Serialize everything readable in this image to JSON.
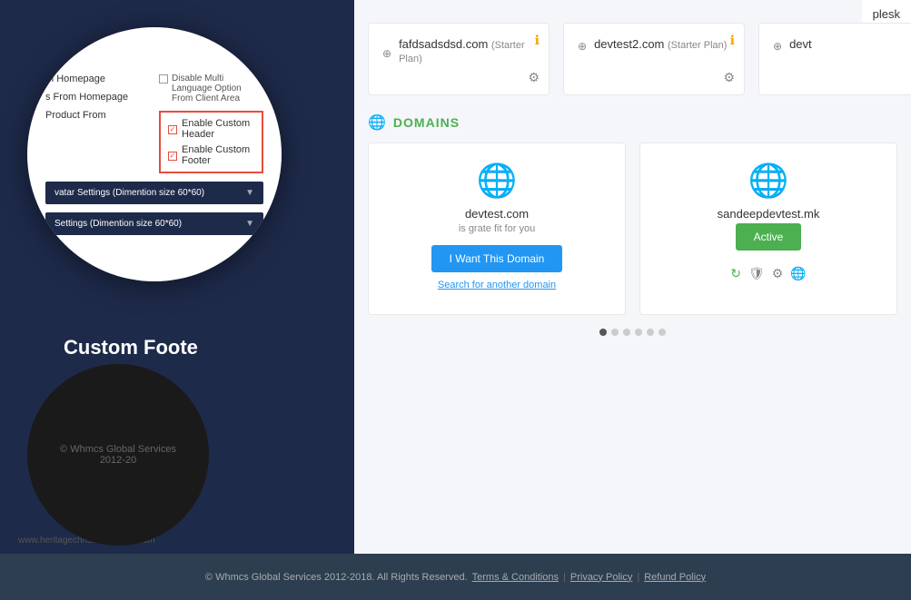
{
  "magnified": {
    "labels": {
      "homepage": "m Homepage",
      "from_homepage": "s From Homepage",
      "product_from": "Product From"
    },
    "disable_option": "Disable Multi Language Option From Client Area",
    "custom_options": {
      "header": "Enable Custom Header",
      "footer": "Enable Custom Footer"
    },
    "accordion": [
      {
        "label": "vatar Settings (Dimention size 60*60)"
      },
      {
        "label": "Settings (Dimention size 60*60)"
      }
    ]
  },
  "left_panel": {
    "custom_footer_label": "Custom Foote",
    "footer_url": "www.heritagechristiancollege.com"
  },
  "right_panel": {
    "hosting_cards": [
      {
        "title": "fafdsadsdsd.com",
        "subtitle": "(Starter Plan)"
      },
      {
        "title": "devtest2.com",
        "subtitle": "(Starter Plan)"
      },
      {
        "title": "devt",
        "subtitle": ""
      }
    ],
    "plesk_label": "plesk",
    "domains_header": "DOMAINS",
    "domain_cards": [
      {
        "name": "devtest.com",
        "tagline": "is grate fit for you",
        "cta": "I Want This Domain",
        "search_link": "Search for another domain",
        "globe_color": "blue",
        "status": null
      },
      {
        "name": "sandeepdevtest.mk",
        "tagline": "",
        "cta": null,
        "search_link": null,
        "globe_color": "green",
        "status": "Active"
      }
    ],
    "pagination_dots": [
      true,
      false,
      false,
      false,
      false,
      false
    ]
  },
  "footer": {
    "copyright": "© Whmcs Global Services 2012-2018. All Rights Reserved.",
    "terms_link": "Terms & Conditions",
    "separator1": "|",
    "privacy_link": "Privacy Policy",
    "separator2": "|",
    "refund_link": "Refund Policy"
  },
  "black_circle": {
    "copyright": "© Whmcs Global Services 2012-20"
  }
}
